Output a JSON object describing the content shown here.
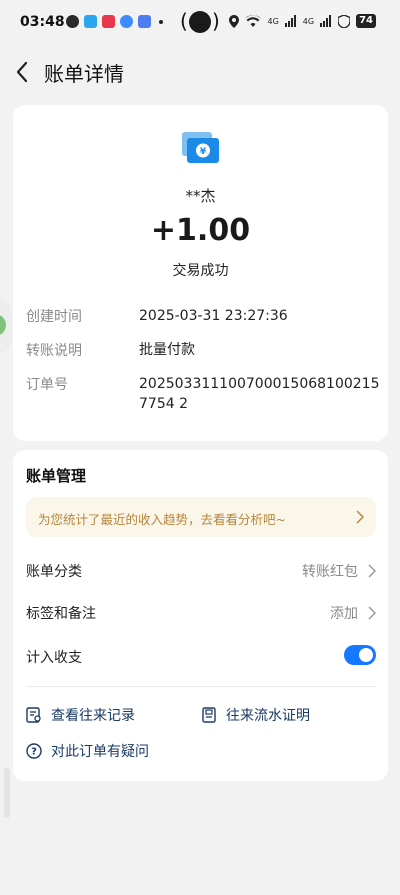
{
  "status_bar": {
    "time": "03:48",
    "net_label": "4G",
    "battery": "74"
  },
  "header": {
    "title": "账单详情"
  },
  "transaction": {
    "payer": "**杰",
    "amount": "+1.00",
    "status": "交易成功",
    "details": [
      {
        "label": "创建时间",
        "value": "2025-03-31 23:27:36"
      },
      {
        "label": "转账说明",
        "value": "批量付款"
      },
      {
        "label": "订单号",
        "value": "2025033111007000150681002157754 2"
      }
    ]
  },
  "management": {
    "title": "账单管理",
    "banner": "为您统计了最近的收入趋势，去看看分析吧~",
    "category": {
      "label": "账单分类",
      "value": "转账红包"
    },
    "tags": {
      "label": "标签和备注",
      "value": "添加"
    },
    "include": {
      "label": "计入收支",
      "enabled": true
    },
    "links": {
      "records": "查看往来记录",
      "proof": "往来流水证明",
      "question": "对此订单有疑问"
    }
  },
  "colors": {
    "accent": "#1677ff",
    "banner_bg": "#fbf6ea",
    "banner_text": "#b8863b",
    "link_text": "#1a3a66"
  }
}
